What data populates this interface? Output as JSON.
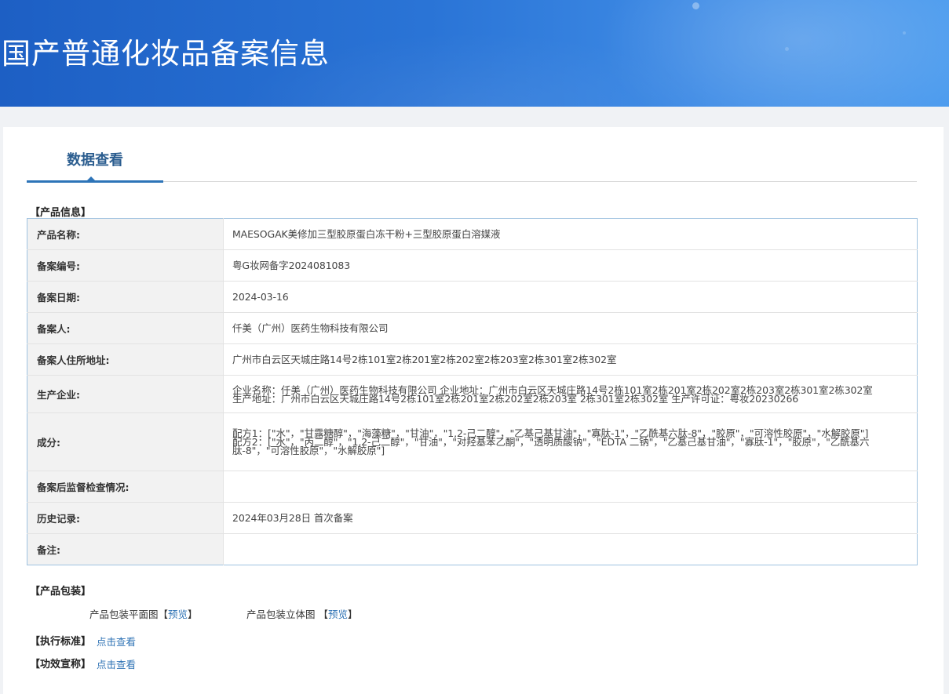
{
  "header": {
    "title": "国产普通化妆品备案信息"
  },
  "tabs": [
    {
      "label": "数据查看",
      "active": true
    }
  ],
  "product_info": {
    "section_title": "【产品信息】",
    "rows": [
      {
        "label": "产品名称:",
        "value": "MAESOGAK美修加三型胶原蛋白冻干粉+三型胶原蛋白溶媒液"
      },
      {
        "label": "备案编号:",
        "value": "粤G妆网备字2024081083"
      },
      {
        "label": "备案日期:",
        "value": "2024-03-16"
      },
      {
        "label": "备案人:",
        "value": "仟美（广州）医药生物科技有限公司"
      },
      {
        "label": "备案人住所地址:",
        "value": "广州市白云区天城庄路14号2栋101室2栋201室2栋202室2栋203室2栋301室2栋302室"
      },
      {
        "label": "生产企业:",
        "value": "企业名称：仟美（广州）医药生物科技有限公司 企业地址：广州市白云区天城庄路14号2栋101室2栋201室2栋202室2栋203室2栋301室2栋302室 生产地址：广州市白云区天城庄路14号2栋101室2栋201室2栋202室2栋203室 2栋301室2栋302室 生产许可证：粤妆20230266"
      },
      {
        "label": "成分:",
        "value_lines": [
          "配方1：[\"水\"，\"甘露糖醇\"，\"海藻糖\"，\"甘油\"，\"1,2-己二醇\"，\"乙基己基甘油\"，\"寡肽-1\"，\"乙酰基六肽-8\"，\"胶原\"，\"可溶性胶原\"，\"水解胶原\"]",
          "配方2：[\"水\"，\"丙二醇\"，\"1,2-己二醇\"，\"甘油\"，\"对羟基苯乙酮\"，\"透明质酸钠\"，\"EDTA 二钠\"，\"乙基己基甘油\"，\"寡肽-1\"，\"胶原\"，\"乙酰基六肽-8\"，\"可溶性胶原\"，\"水解胶原\"]"
        ]
      },
      {
        "label": "备案后监督检查情况:",
        "value": ""
      },
      {
        "label": "历史记录:",
        "value": "2024年03月28日 首次备案"
      },
      {
        "label": "备注:",
        "value": ""
      }
    ]
  },
  "packaging": {
    "section_title": "【产品包装】",
    "flat_label": "产品包装平面图",
    "flat_link": "预览",
    "solid_label": "产品包装立体图",
    "solid_link": "预览",
    "bracket_open": "【",
    "bracket_close": "】"
  },
  "standard": {
    "section_title": "【执行标准】",
    "link": "点击查看"
  },
  "efficacy": {
    "section_title": "【功效宣称】",
    "link": "点击查看"
  },
  "colors": {
    "banner": "#2a74d6",
    "accent": "#2d74b8",
    "link": "#2f73b5",
    "table_border": "#9fc2e0",
    "label_bg": "#f2f2f2"
  }
}
